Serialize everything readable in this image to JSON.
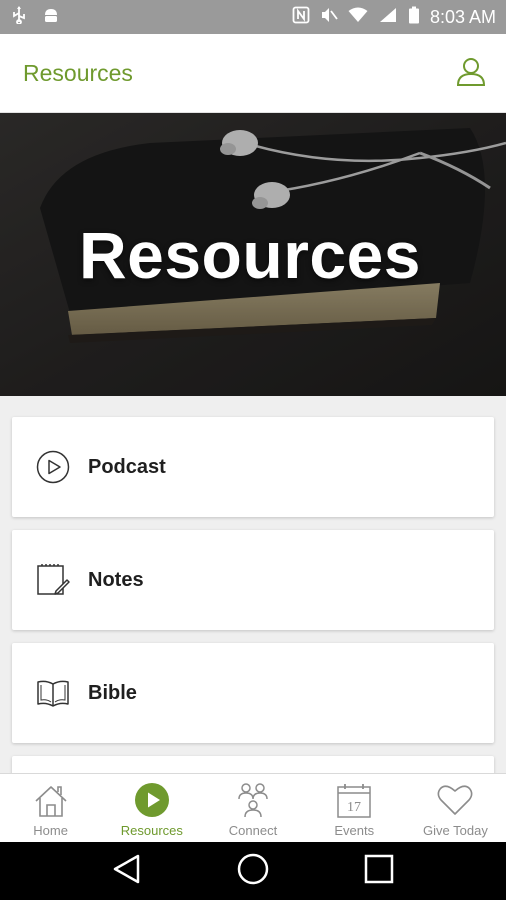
{
  "status_bar": {
    "time": "8:03 AM",
    "left_icons": [
      "usb-icon",
      "android-icon"
    ],
    "right_icons": [
      "nfc-icon",
      "mute-icon",
      "wifi-icon",
      "signal-icon",
      "battery-icon"
    ]
  },
  "app_bar": {
    "title": "Resources",
    "profile_icon": "person-icon"
  },
  "hero": {
    "title": "Resources"
  },
  "list": {
    "items": [
      {
        "label": "Podcast",
        "icon": "play-circle-icon"
      },
      {
        "label": "Notes",
        "icon": "notepad-icon"
      },
      {
        "label": "Bible",
        "icon": "book-icon"
      }
    ]
  },
  "tabs": [
    {
      "label": "Home",
      "icon": "house-icon",
      "active": false
    },
    {
      "label": "Resources",
      "icon": "play-circle-icon",
      "active": true
    },
    {
      "label": "Connect",
      "icon": "people-icon",
      "active": false
    },
    {
      "label": "Events",
      "icon": "calendar-icon",
      "calendar_day": "17",
      "active": false
    },
    {
      "label": "Give Today",
      "icon": "heart-icon",
      "active": false
    }
  ],
  "colors": {
    "accent": "#6f9a2e",
    "status_bar": "#9a9a9a",
    "tab_inactive": "#8c8c8c",
    "card_text": "#1f1f1f"
  }
}
